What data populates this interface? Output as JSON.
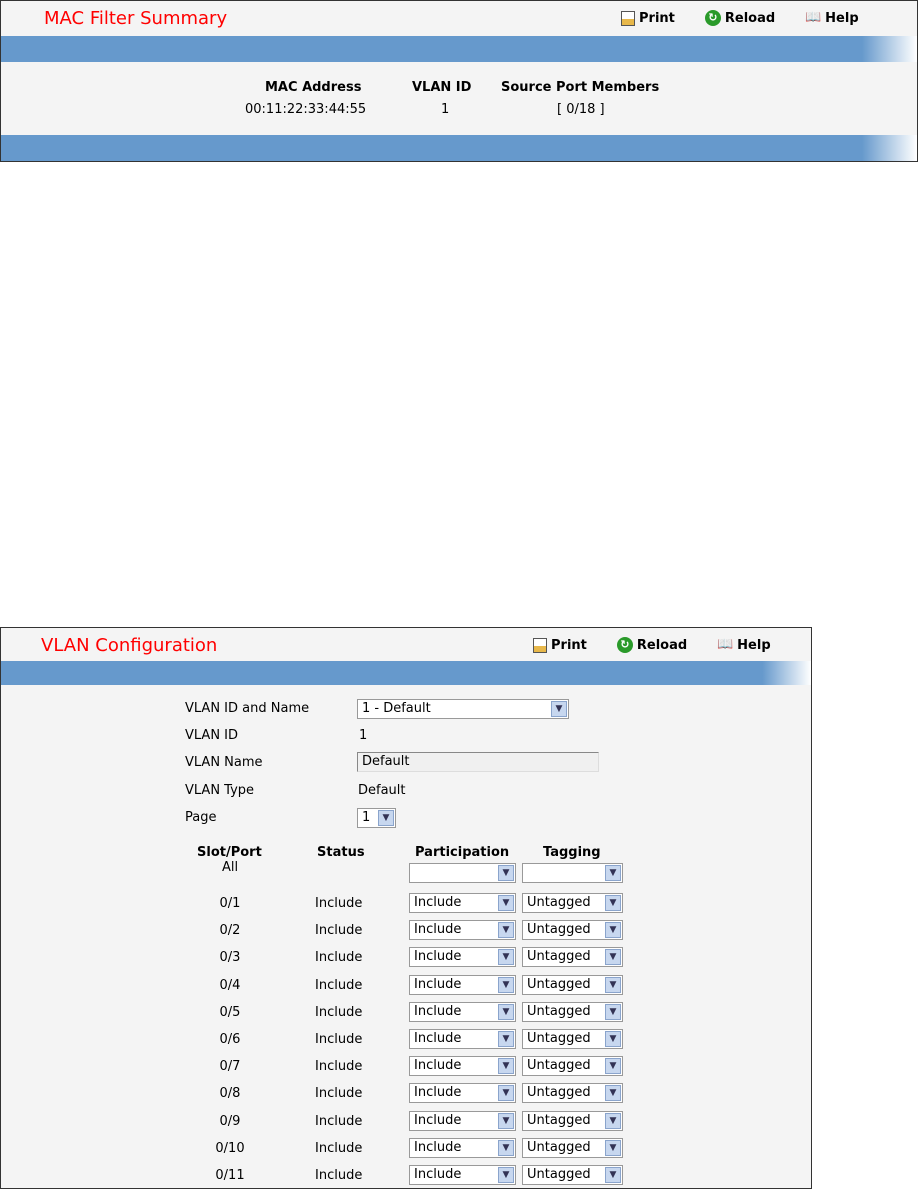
{
  "mac_panel": {
    "title": "MAC Filter Summary",
    "toolbar": {
      "print": "Print",
      "reload": "Reload",
      "help": "Help"
    },
    "columns": [
      "MAC Address",
      "VLAN ID",
      "Source Port Members"
    ],
    "rows": [
      {
        "mac": "00:11:22:33:44:55",
        "vlan": "1",
        "ports": "[ 0/18 ]"
      }
    ]
  },
  "vlan_panel": {
    "title": "VLAN Configuration",
    "toolbar": {
      "print": "Print",
      "reload": "Reload",
      "help": "Help"
    },
    "fields": {
      "id_name_label": "VLAN ID and Name",
      "id_name_value": "1 - Default",
      "id_label": "VLAN ID",
      "id_value": "1",
      "name_label": "VLAN Name",
      "name_value": "Default",
      "type_label": "VLAN Type",
      "type_value": "Default",
      "page_label": "Page",
      "page_value": "1"
    },
    "columns": [
      "Slot/Port",
      "Status",
      "Participation",
      "Tagging"
    ],
    "all_row": {
      "port": "All",
      "participation": "",
      "tagging": ""
    },
    "rows": [
      {
        "port": "0/1",
        "status": "Include",
        "participation": "Include",
        "tagging": "Untagged"
      },
      {
        "port": "0/2",
        "status": "Include",
        "participation": "Include",
        "tagging": "Untagged"
      },
      {
        "port": "0/3",
        "status": "Include",
        "participation": "Include",
        "tagging": "Untagged"
      },
      {
        "port": "0/4",
        "status": "Include",
        "participation": "Include",
        "tagging": "Untagged"
      },
      {
        "port": "0/5",
        "status": "Include",
        "participation": "Include",
        "tagging": "Untagged"
      },
      {
        "port": "0/6",
        "status": "Include",
        "participation": "Include",
        "tagging": "Untagged"
      },
      {
        "port": "0/7",
        "status": "Include",
        "participation": "Include",
        "tagging": "Untagged"
      },
      {
        "port": "0/8",
        "status": "Include",
        "participation": "Include",
        "tagging": "Untagged"
      },
      {
        "port": "0/9",
        "status": "Include",
        "participation": "Include",
        "tagging": "Untagged"
      },
      {
        "port": "0/10",
        "status": "Include",
        "participation": "Include",
        "tagging": "Untagged"
      },
      {
        "port": "0/11",
        "status": "Include",
        "participation": "Include",
        "tagging": "Untagged"
      }
    ]
  },
  "colors": {
    "title": "#ff0000",
    "bar": "#6699cc",
    "panel_bg": "#f4f4f4"
  }
}
